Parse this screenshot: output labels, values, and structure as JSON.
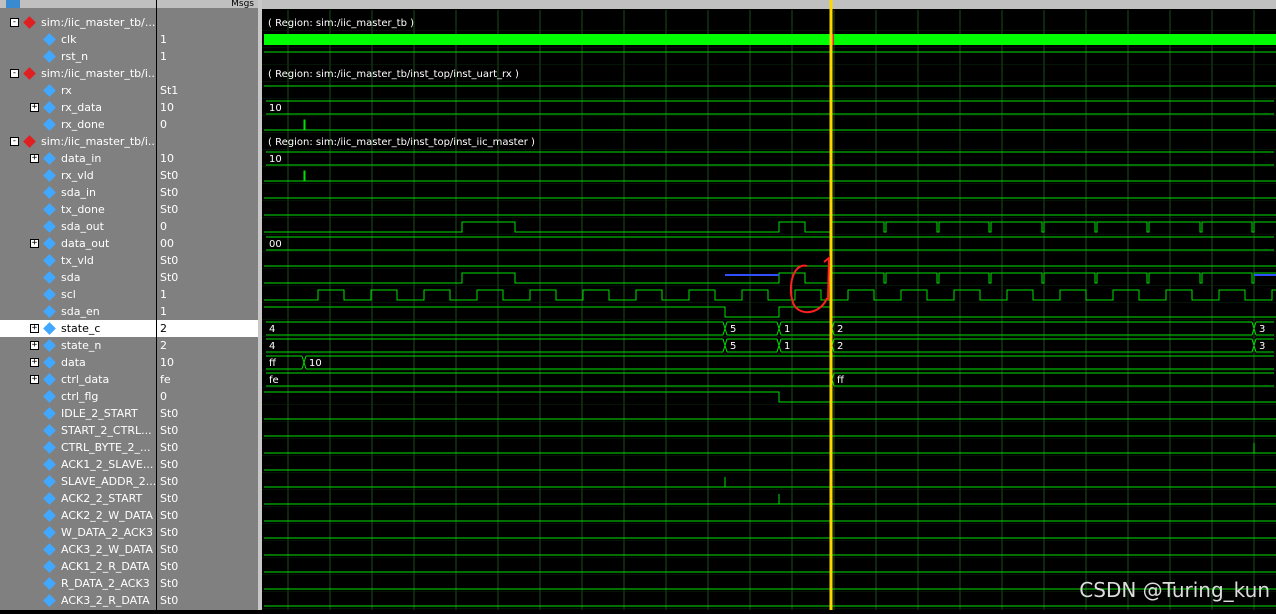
{
  "header": {
    "msgs_label": "Msgs"
  },
  "rows": [
    {
      "name": "sim:/iic_master_tb/...",
      "value": "",
      "indent": 0,
      "toggle": "-",
      "kind": "group"
    },
    {
      "name": "clk",
      "value": "1",
      "indent": 1,
      "toggle": "",
      "kind": "in"
    },
    {
      "name": "rst_n",
      "value": "1",
      "indent": 1,
      "toggle": "",
      "kind": "in"
    },
    {
      "name": "sim:/iic_master_tb/i...",
      "value": "",
      "indent": 0,
      "toggle": "-",
      "kind": "group"
    },
    {
      "name": "rx",
      "value": "St1",
      "indent": 1,
      "toggle": "",
      "kind": "in"
    },
    {
      "name": "rx_data",
      "value": "10",
      "indent": 1,
      "toggle": "+",
      "kind": "out"
    },
    {
      "name": "rx_done",
      "value": "0",
      "indent": 1,
      "toggle": "",
      "kind": "out"
    },
    {
      "name": "sim:/iic_master_tb/i...",
      "value": "",
      "indent": 0,
      "toggle": "-",
      "kind": "group"
    },
    {
      "name": "data_in",
      "value": "10",
      "indent": 1,
      "toggle": "+",
      "kind": "in"
    },
    {
      "name": "rx_vld",
      "value": "St0",
      "indent": 1,
      "toggle": "",
      "kind": "in"
    },
    {
      "name": "sda_in",
      "value": "St0",
      "indent": 1,
      "toggle": "",
      "kind": "in"
    },
    {
      "name": "tx_done",
      "value": "St0",
      "indent": 1,
      "toggle": "",
      "kind": "in"
    },
    {
      "name": "sda_out",
      "value": "0",
      "indent": 1,
      "toggle": "",
      "kind": "out"
    },
    {
      "name": "data_out",
      "value": "00",
      "indent": 1,
      "toggle": "+",
      "kind": "out"
    },
    {
      "name": "tx_vld",
      "value": "St0",
      "indent": 1,
      "toggle": "",
      "kind": "out"
    },
    {
      "name": "sda",
      "value": "St0",
      "indent": 1,
      "toggle": "",
      "kind": "out"
    },
    {
      "name": "scl",
      "value": "1",
      "indent": 1,
      "toggle": "",
      "kind": "out"
    },
    {
      "name": "sda_en",
      "value": "1",
      "indent": 1,
      "toggle": "",
      "kind": "out"
    },
    {
      "name": "state_c",
      "value": "2",
      "indent": 1,
      "toggle": "+",
      "kind": "in",
      "selected": true
    },
    {
      "name": "state_n",
      "value": "2",
      "indent": 1,
      "toggle": "+",
      "kind": "in"
    },
    {
      "name": "data",
      "value": "10",
      "indent": 1,
      "toggle": "+",
      "kind": "in"
    },
    {
      "name": "ctrl_data",
      "value": "fe",
      "indent": 1,
      "toggle": "+",
      "kind": "in"
    },
    {
      "name": "ctrl_flg",
      "value": "0",
      "indent": 1,
      "toggle": "",
      "kind": "in"
    },
    {
      "name": "IDLE_2_START",
      "value": "St0",
      "indent": 1,
      "toggle": "",
      "kind": "in"
    },
    {
      "name": "START_2_CTRL...",
      "value": "St0",
      "indent": 1,
      "toggle": "",
      "kind": "in"
    },
    {
      "name": "CTRL_BYTE_2_...",
      "value": "St0",
      "indent": 1,
      "toggle": "",
      "kind": "in"
    },
    {
      "name": "ACK1_2_SLAVE...",
      "value": "St0",
      "indent": 1,
      "toggle": "",
      "kind": "in"
    },
    {
      "name": "SLAVE_ADDR_2...",
      "value": "St0",
      "indent": 1,
      "toggle": "",
      "kind": "in"
    },
    {
      "name": "ACK2_2_START",
      "value": "St0",
      "indent": 1,
      "toggle": "",
      "kind": "in"
    },
    {
      "name": "ACK2_2_W_DATA",
      "value": "St0",
      "indent": 1,
      "toggle": "",
      "kind": "in"
    },
    {
      "name": "W_DATA_2_ACK3",
      "value": "St0",
      "indent": 1,
      "toggle": "",
      "kind": "in"
    },
    {
      "name": "ACK3_2_W_DATA",
      "value": "St0",
      "indent": 1,
      "toggle": "",
      "kind": "in"
    },
    {
      "name": "ACK1_2_R_DATA",
      "value": "St0",
      "indent": 1,
      "toggle": "",
      "kind": "in"
    },
    {
      "name": "R_DATA_2_ACK3",
      "value": "St0",
      "indent": 1,
      "toggle": "",
      "kind": "in"
    },
    {
      "name": "ACK3_2_R_DATA",
      "value": "St0",
      "indent": 1,
      "toggle": "",
      "kind": "in"
    }
  ],
  "regions": [
    {
      "row": 0,
      "text": "( Region: sim:/iic_master_tb )"
    },
    {
      "row": 3,
      "text": "( Region: sim:/iic_master_tb/inst_top/inst_uart_rx )"
    },
    {
      "row": 7,
      "text": "( Region: sim:/iic_master_tb/inst_top/inst_iic_master )"
    }
  ],
  "bus_labels": {
    "rx_data": [
      "10"
    ],
    "data_in": [
      "10"
    ],
    "data_out": [
      "00"
    ],
    "state_c": [
      "4",
      "5",
      "1",
      "2",
      "3"
    ],
    "state_n": [
      "4",
      "5",
      "1",
      "2",
      "3"
    ],
    "data": [
      "ff",
      "10"
    ],
    "ctrl_data": [
      "fe",
      "ff"
    ]
  },
  "colors": {
    "wave": "#00e000",
    "clock_fill": "#00ff00",
    "cursor": "#ffd700",
    "annotation": "#ff2020",
    "z_state": "#3050ff",
    "group_diamond": "#e02020",
    "in_diamond": "#40a8ff"
  },
  "watermark": "CSDN @Turing_kun"
}
